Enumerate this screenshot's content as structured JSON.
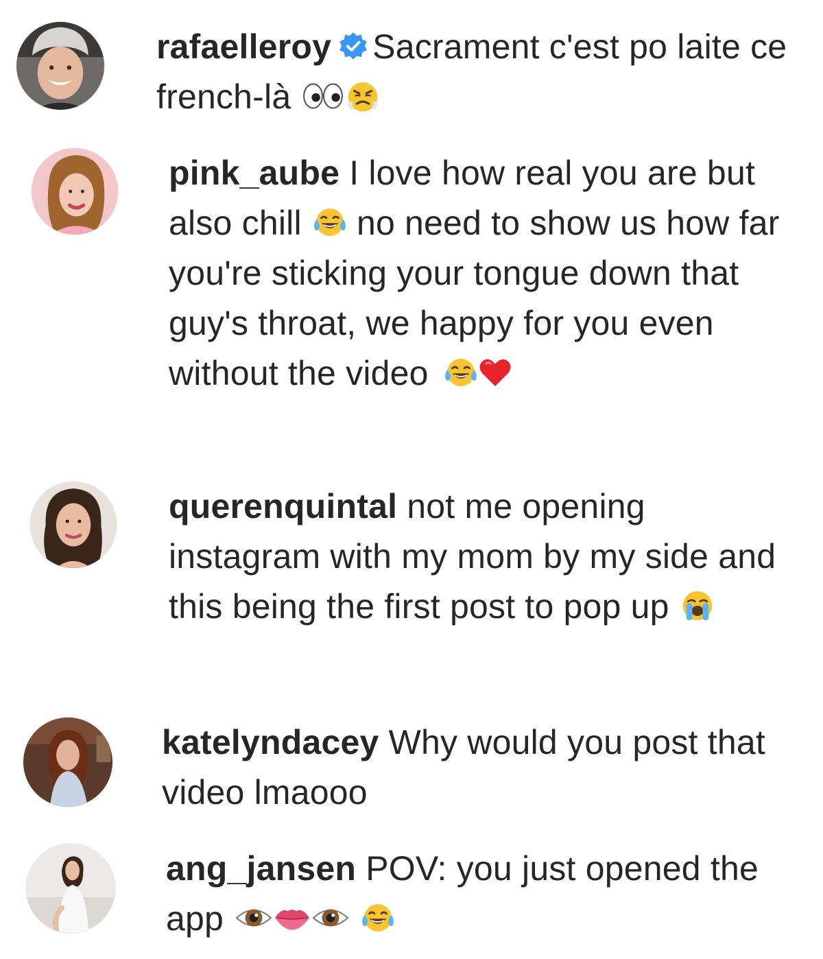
{
  "comments": [
    {
      "username": "rafaelleroy",
      "verified": true,
      "text": "Sacrament c'est po laite ce french-là",
      "emojis": [
        "eyes-emoji-icon",
        "face-with-steam-emoji-icon"
      ]
    },
    {
      "username": "pink_aube",
      "text_part1": "I love how real you are but also chill",
      "text_part2": "no need to show us how far you're sticking your tongue down that guy's throat, we happy for you even without the video",
      "emojis_mid": [
        "tears-of-joy-emoji-icon"
      ],
      "emojis_end": [
        "tears-of-joy-emoji-icon",
        "red-heart-emoji-icon"
      ]
    },
    {
      "username": "querenquintal",
      "text": "not me opening instagram with my mom by my side and this being the first post to pop up",
      "emojis": [
        "loudly-crying-emoji-icon"
      ]
    },
    {
      "username": "katelyndacey",
      "text": "Why would you post that video lmaooo",
      "emojis": []
    },
    {
      "username": "ang_jansen",
      "text": "POV: you just opened the app",
      "emojis": [
        "eye-emoji-icon",
        "lips-emoji-icon",
        "eye-emoji-icon",
        "tears-of-joy-emoji-icon"
      ]
    }
  ],
  "colors": {
    "text": "#262626",
    "verified_badge": "#3897f0",
    "background": "#ffffff"
  }
}
